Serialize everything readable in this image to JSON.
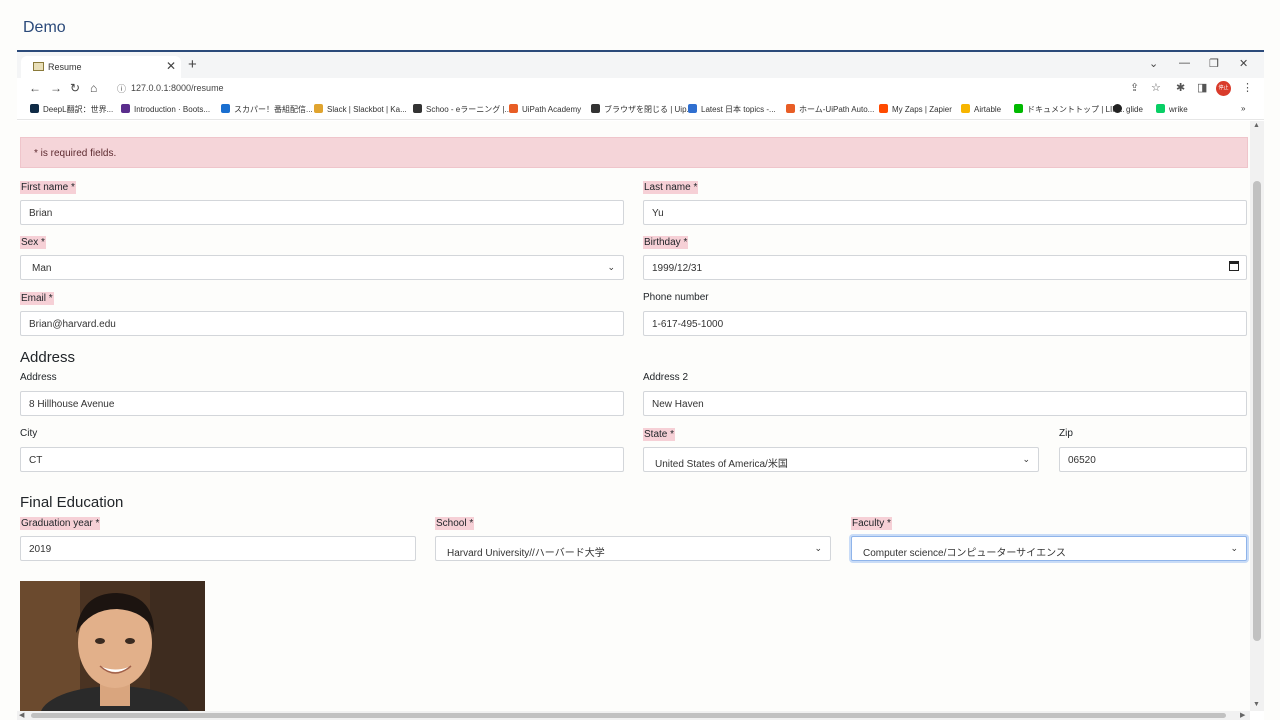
{
  "demo": {
    "title": "Demo"
  },
  "browser": {
    "tab_title": "Resume",
    "tab_close": "✕",
    "new_tab": "+",
    "url": "127.0.0.1:8000/resume",
    "profile_label": "停止",
    "bookmarks": [
      {
        "label": "DeepL翻訳：世界...",
        "color": "#0f2b46"
      },
      {
        "label": "Introduction · Boots...",
        "color": "#5a2d8c"
      },
      {
        "label": "スカパー！番組配信...",
        "color": "#1a6fd0"
      },
      {
        "label": "Slack | Slackbot | Ka...",
        "color": "#e0a42f"
      },
      {
        "label": "Schoo - eラーニング |...",
        "color": "#333333"
      },
      {
        "label": "UiPath Academy",
        "color": "#e85d25"
      },
      {
        "label": "ブラウザを閉じる | Uip...",
        "color": "#333333"
      },
      {
        "label": "Latest 日本 topics -...",
        "color": "#2f6fd0"
      },
      {
        "label": "ホーム-UiPath Auto...",
        "color": "#e85d25"
      },
      {
        "label": "My Zaps | Zapier",
        "color": "#ff4a00"
      },
      {
        "label": "Airtable",
        "color": "#f7b500"
      },
      {
        "label": "ドキュメントトップ | LIN...",
        "color": "#00b900"
      },
      {
        "label": "glide",
        "color": "#222222"
      },
      {
        "label": "wrike",
        "color": "#08cf65"
      }
    ]
  },
  "form": {
    "alert": "* is required fields.",
    "first_name": {
      "label": "First name *",
      "value": "Brian"
    },
    "last_name": {
      "label": "Last name *",
      "value": "Yu"
    },
    "sex": {
      "label": "Sex *",
      "value": "Man"
    },
    "birthday": {
      "label": "Birthday *",
      "value": "1999/12/31"
    },
    "email": {
      "label": "Email *",
      "value": "Brian@harvard.edu"
    },
    "phone": {
      "label": "Phone number",
      "value": "1-617-495-1000"
    },
    "address_heading": "Address",
    "address": {
      "label": "Address",
      "value": "8 Hillhouse Avenue"
    },
    "address2": {
      "label": "Address 2",
      "value": "New Haven"
    },
    "city": {
      "label": "City",
      "value": "CT"
    },
    "state": {
      "label": "State *",
      "value": "United States of America/米国"
    },
    "zip": {
      "label": "Zip",
      "value": "06520"
    },
    "education_heading": "Final Education",
    "graduation_year": {
      "label": "Graduation year *",
      "value": "2019"
    },
    "school": {
      "label": "School *",
      "value": "Harvard University//ハーバード大学"
    },
    "faculty": {
      "label": "Faculty *",
      "value": "Computer science/コンピューターサイエンス"
    }
  }
}
